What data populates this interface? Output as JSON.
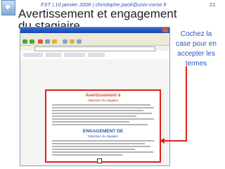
{
  "header": {
    "text": "FST | 10 janvier 2006 | christophe.paoli@univ-corse.fr",
    "slide_number": "21"
  },
  "title": "Avertissement et engagement du stagiaire",
  "callout": "Cochez la case pour en accepter les termes",
  "document": {
    "heading1": "Avertissement à",
    "subheading1": "l'attention du stagiaire",
    "heading2": "ENGAGEMENT DE",
    "subheading2": "l'attention du stagiaire"
  },
  "colors": {
    "accent": "#e02020",
    "brand": "#2a56b3"
  }
}
